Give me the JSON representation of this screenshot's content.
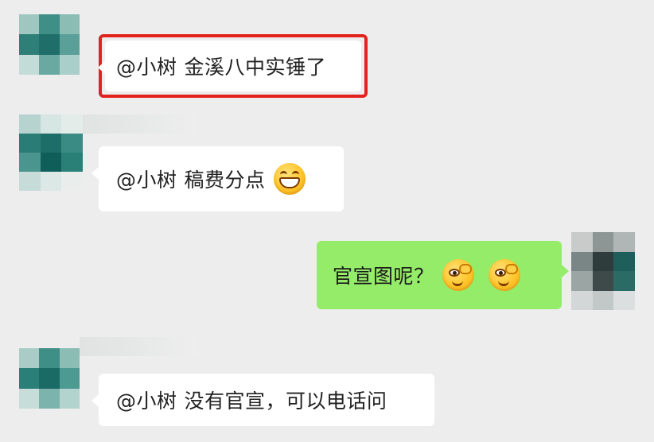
{
  "messages": [
    {
      "direction": "incoming",
      "mention": "@小树",
      "text": "金溪八中实锤了",
      "highlighted": true
    },
    {
      "direction": "incoming",
      "mention": "@小树",
      "text": "稿费分点",
      "emoji": "grinning-face-emoji"
    },
    {
      "direction": "outgoing",
      "text": "官宣图呢？",
      "emojis": [
        "winking-face-emoji",
        "winking-face-emoji"
      ]
    },
    {
      "direction": "incoming",
      "mention": "@小树",
      "text": "没有官宣，可以电话问"
    }
  ],
  "colors": {
    "background": "#ededed",
    "incoming_bubble": "#ffffff",
    "outgoing_bubble": "#95ec69",
    "highlight_border": "#e3211d"
  }
}
